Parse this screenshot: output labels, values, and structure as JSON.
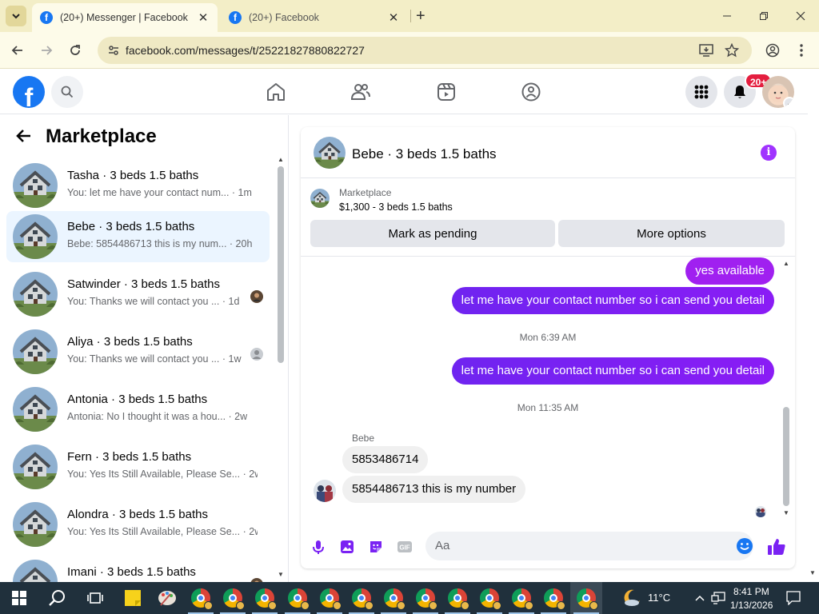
{
  "browser": {
    "tabs": [
      {
        "title": "(20+) Messenger | Facebook",
        "active": true
      },
      {
        "title": "(20+) Facebook",
        "active": false
      }
    ],
    "url": "facebook.com/messages/t/25221827880822727"
  },
  "facebook": {
    "notification_badge": "20+"
  },
  "left_panel": {
    "title": "Marketplace",
    "conversations": [
      {
        "name": "Tasha · 3 beds 1.5 baths",
        "preview": "You: let me have your contact num...",
        "time": "· 1m",
        "selected": false
      },
      {
        "name": "Bebe · 3 beds 1.5 baths",
        "preview": "Bebe: 5854486713 this is my num...",
        "time": "· 20h",
        "selected": true
      },
      {
        "name": "Satwinder · 3 beds 1.5 baths",
        "preview": "You: Thanks we will contact you ...",
        "time": "· 1d",
        "selected": false
      },
      {
        "name": "Aliya · 3 beds 1.5 baths",
        "preview": "You: Thanks we will contact you ...",
        "time": "· 1w",
        "selected": false
      },
      {
        "name": "Antonia · 3 beds 1.5 baths",
        "preview": "Antonia: No I thought it was a hou...",
        "time": "· 2w",
        "selected": false
      },
      {
        "name": "Fern · 3 beds 1.5 baths",
        "preview": "You: Yes Its Still Available, Please Se...",
        "time": "· 2w",
        "selected": false
      },
      {
        "name": "Alondra · 3 beds 1.5 baths",
        "preview": "You: Yes Its Still Available, Please Se...",
        "time": "· 2w",
        "selected": false
      },
      {
        "name": "Imani · 3 beds 1.5 baths",
        "preview": "",
        "time": "",
        "selected": false
      }
    ]
  },
  "chat": {
    "header_name": "Bebe · 3 beds 1.5 baths",
    "marketplace_label": "Marketplace",
    "listing": "$1,300 - 3 beds 1.5 baths",
    "mark_pending_label": "Mark as pending",
    "more_options_label": "More options",
    "messages": {
      "m1": "yes available",
      "m2": "let me have your contact number so i can send you detail",
      "ts1": "Mon 6:39 AM",
      "m3": "let me have your contact number so i can send you detail",
      "ts2": "Mon 11:35 AM",
      "sender": "Bebe",
      "m4": "5853486714",
      "m5": "5854486713 this is my number"
    },
    "composer_placeholder": "Aa"
  },
  "taskbar": {
    "weather": "11°C",
    "time": "8:41 PM",
    "date": "1/13/2026"
  },
  "colors": {
    "fb_blue": "#1877f2",
    "messenger_purple": "#7a22f3",
    "badge_red": "#e41e3f",
    "selected_bg": "#ebf5ff"
  }
}
